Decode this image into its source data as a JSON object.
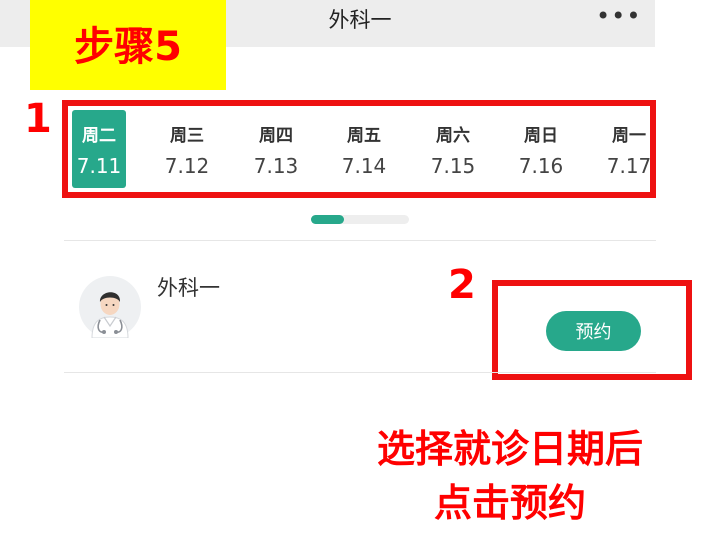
{
  "header": {
    "title": "外科一",
    "more_icon": "more-dots-icon"
  },
  "step_badge": {
    "text": "步骤5",
    "background": "#ffff00",
    "color": "#ff0000"
  },
  "callouts": {
    "one": "1",
    "two": "2"
  },
  "dates": [
    {
      "weekday": "周二",
      "date": "7.11",
      "selected": true
    },
    {
      "weekday": "周三",
      "date": "7.12",
      "selected": false
    },
    {
      "weekday": "周四",
      "date": "7.13",
      "selected": false
    },
    {
      "weekday": "周五",
      "date": "7.14",
      "selected": false
    },
    {
      "weekday": "周六",
      "date": "7.15",
      "selected": false
    },
    {
      "weekday": "周日",
      "date": "7.16",
      "selected": false
    },
    {
      "weekday": "周一",
      "date": "7.17",
      "selected": false
    }
  ],
  "doctor": {
    "name": "外科一",
    "avatar_icon": "doctor-avatar-icon"
  },
  "book_button": {
    "label": "预约"
  },
  "instruction": {
    "line1": "选择就诊日期后",
    "line2": "点击预约"
  },
  "colors": {
    "accent": "#27a88b",
    "highlight": "#ee1111"
  }
}
